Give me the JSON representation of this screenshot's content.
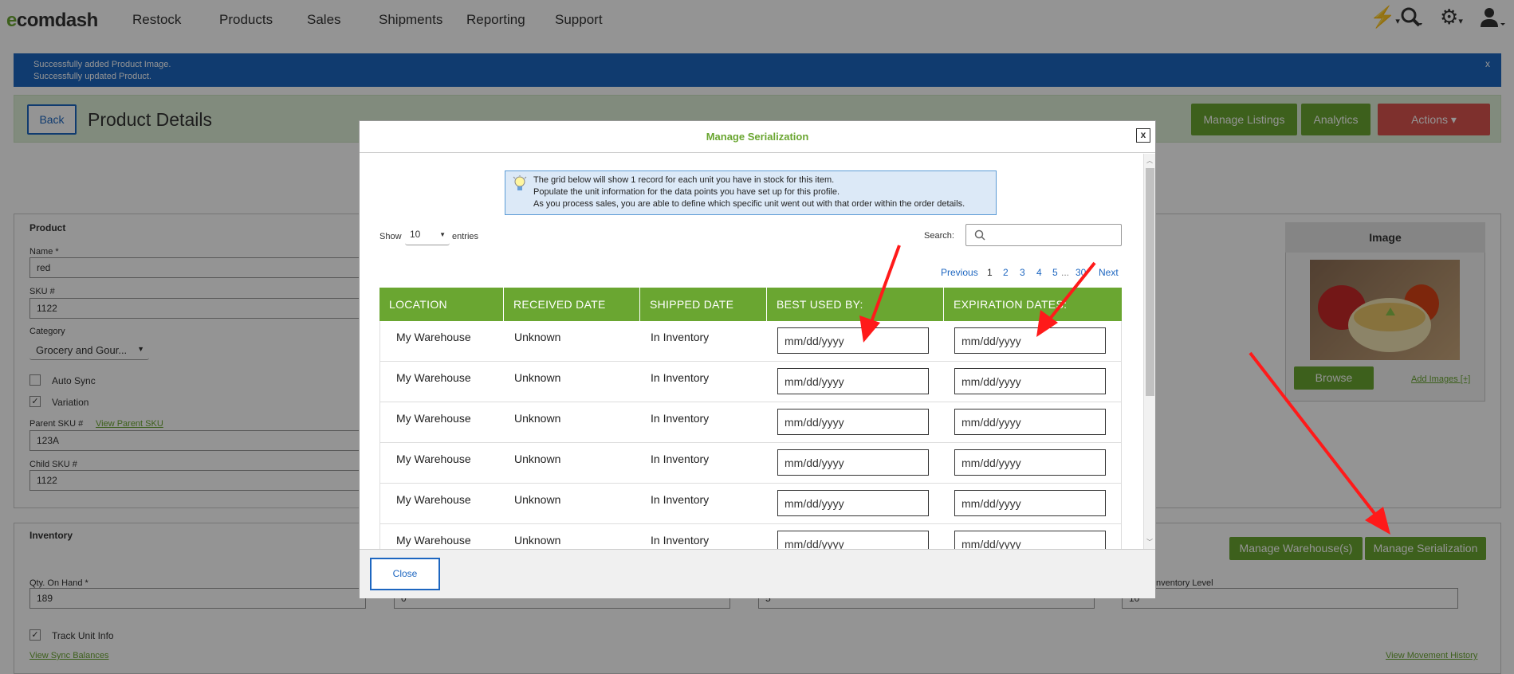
{
  "nav": {
    "logo_prefix": "e",
    "logo_rest": "comdash",
    "items": [
      "Restock",
      "Products",
      "Sales",
      "Shipments",
      "Reporting",
      "Support"
    ],
    "icons": [
      "bolt-icon",
      "search-icon",
      "gear-icon",
      "user-icon"
    ]
  },
  "banner": {
    "line1": "Successfully added Product Image.",
    "line2": "Successfully updated Product.",
    "close": "x"
  },
  "header": {
    "back": "Back",
    "title": "Product Details",
    "manage_listings": "Manage Listings",
    "analytics": "Analytics",
    "actions": "Actions ▾"
  },
  "product": {
    "section": "Product",
    "name_label": "Name *",
    "name_value": "red",
    "sku_label": "SKU #",
    "sku_value": "1122",
    "category_label": "Category",
    "category_value": "Grocery and Gour...",
    "auto_sync": "Auto Sync",
    "variation": "Variation",
    "parent_sku_label": "Parent SKU #",
    "view_parent_sku": "View Parent SKU",
    "parent_sku_value": "123A",
    "child_sku_label": "Child SKU #",
    "child_sku_value": "1122"
  },
  "image_panel": {
    "title": "Image",
    "browse": "Browse",
    "add_images": "Add Images [+]"
  },
  "inventory": {
    "section": "Inventory",
    "manage_warehouses": "Manage Warehouse(s)",
    "manage_serialization": "Manage Serialization",
    "qty_label": "Qty. On Hand *",
    "qty_value": "189",
    "field2_value": "0",
    "field3_value": "5",
    "inv_level_label": "nventory Level",
    "field4_value": "10",
    "track_unit": "Track Unit Info",
    "view_sync": "View Sync Balances",
    "view_movement": "View Movement History"
  },
  "modal": {
    "title": "Manage Serialization",
    "close_x": "x",
    "info_line1": "The grid below will show 1 record for each unit you have in stock for this item.",
    "info_line2": "Populate the unit information for the data points you have set up for this profile.",
    "info_line3": "As you process sales, you are able to define which specific unit went out with that order within the order details.",
    "show": "Show",
    "entries_value": "10",
    "entries": "entries",
    "search_label": "Search:",
    "search_placeholder": "",
    "pager": {
      "previous": "Previous",
      "pages": [
        "1",
        "2",
        "3",
        "4",
        "5",
        "...",
        "30"
      ],
      "next": "Next"
    },
    "columns": [
      "LOCATION",
      "RECEIVED DATE",
      "SHIPPED DATE",
      "BEST USED BY:",
      "EXPIRATION DATES:"
    ],
    "rows": [
      {
        "location": "My Warehouse",
        "received": "Unknown",
        "shipped": "In Inventory",
        "best": "mm/dd/yyyy",
        "exp": "mm/dd/yyyy"
      },
      {
        "location": "My Warehouse",
        "received": "Unknown",
        "shipped": "In Inventory",
        "best": "mm/dd/yyyy",
        "exp": "mm/dd/yyyy"
      },
      {
        "location": "My Warehouse",
        "received": "Unknown",
        "shipped": "In Inventory",
        "best": "mm/dd/yyyy",
        "exp": "mm/dd/yyyy"
      },
      {
        "location": "My Warehouse",
        "received": "Unknown",
        "shipped": "In Inventory",
        "best": "mm/dd/yyyy",
        "exp": "mm/dd/yyyy"
      },
      {
        "location": "My Warehouse",
        "received": "Unknown",
        "shipped": "In Inventory",
        "best": "mm/dd/yyyy",
        "exp": "mm/dd/yyyy"
      },
      {
        "location": "My Warehouse",
        "received": "Unknown",
        "shipped": "In Inventory",
        "best": "mm/dd/yyyy",
        "exp": "mm/dd/yyyy"
      }
    ],
    "close_button": "Close"
  },
  "colors": {
    "brand_green": "#6aa631",
    "banner_blue": "#1d66c0",
    "actions_red": "#d9534f",
    "annotation_red": "#ff1a1a"
  }
}
